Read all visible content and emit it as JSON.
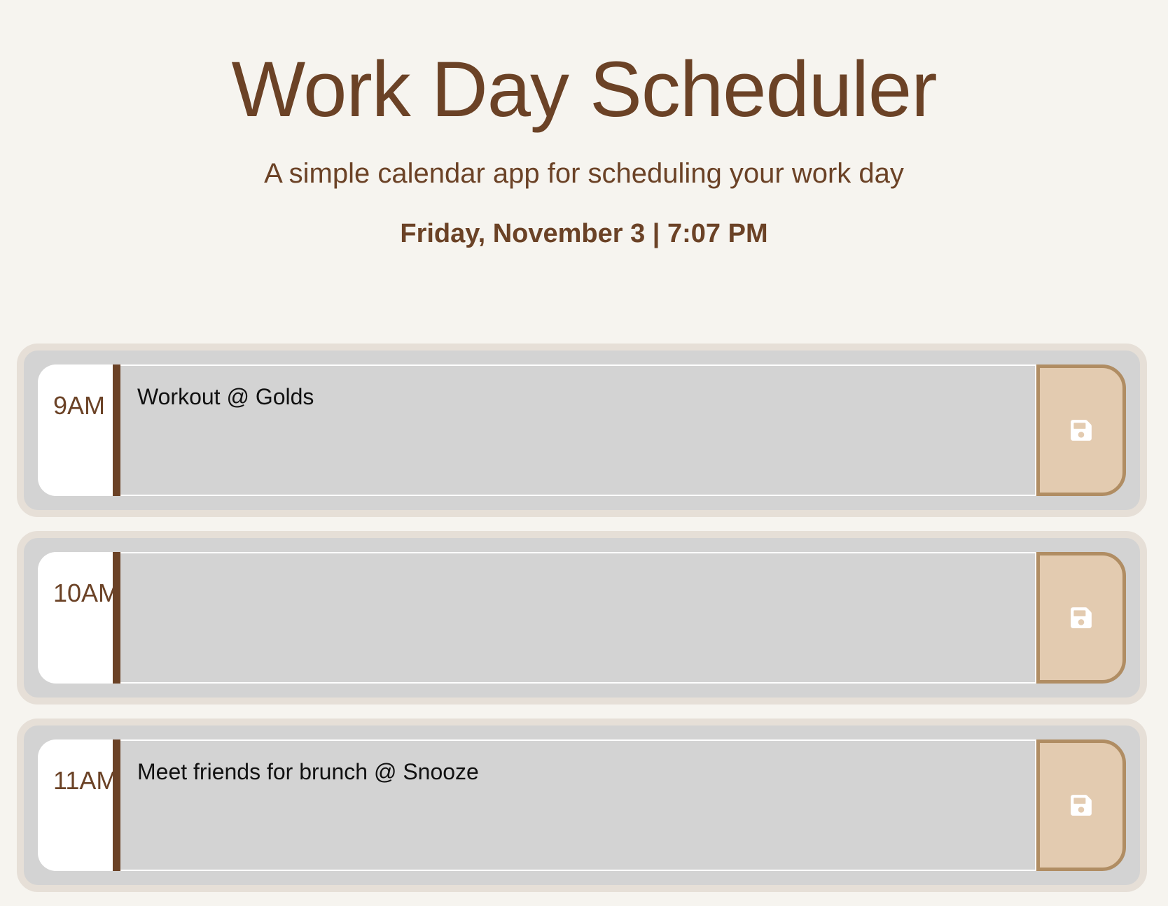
{
  "header": {
    "title": "Work Day Scheduler",
    "subtitle": "A simple calendar app for scheduling your work day",
    "current_day": "Friday, November 3 | 7:07 PM"
  },
  "time_blocks": [
    {
      "hour": "9AM",
      "description": "Workout @ Golds",
      "save_icon": "floppy-disk-icon"
    },
    {
      "hour": "10AM",
      "description": "",
      "save_icon": "floppy-disk-icon"
    },
    {
      "hour": "11AM",
      "description": "Meet friends for brunch @ Snooze",
      "save_icon": "floppy-disk-icon"
    }
  ],
  "colors": {
    "background": "#f6f4ef",
    "brand": "#6b4226",
    "past_block": "#d3d3d3",
    "save_button": "#e3cbb0",
    "save_button_border": "#b08d63"
  }
}
